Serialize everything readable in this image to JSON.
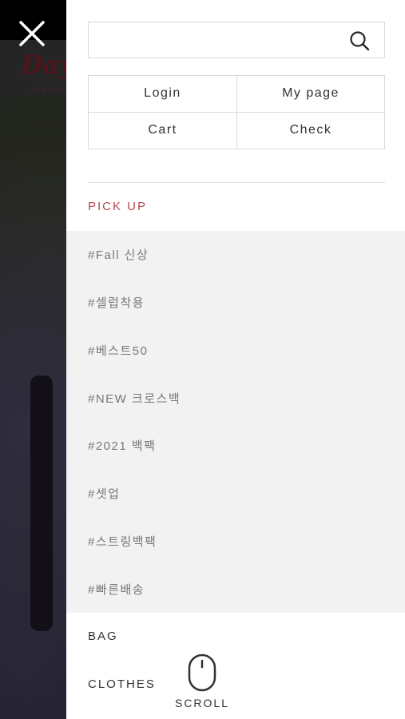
{
  "background": {
    "logo_text": "Day",
    "logo_subtext": "WITH YOUR"
  },
  "close": {
    "icon": "close-icon"
  },
  "search": {
    "placeholder": "",
    "value": "",
    "icon": "search-icon"
  },
  "account": {
    "login": "Login",
    "my_page": "My page",
    "cart": "Cart",
    "check": "Check"
  },
  "pickup": {
    "title": "PICK UP",
    "title_color": "#b5484e",
    "tags": [
      "#Fall 신상",
      "#셀럽착용",
      "#베스트50",
      "#NEW 크로스백",
      "#2021 백팩",
      "#셋업",
      "#스트링백팩",
      "#빠른배송"
    ]
  },
  "categories": [
    "BAG",
    "CLOTHES"
  ],
  "scroll_hint": {
    "label": "SCROLL",
    "icon": "mouse-icon"
  }
}
